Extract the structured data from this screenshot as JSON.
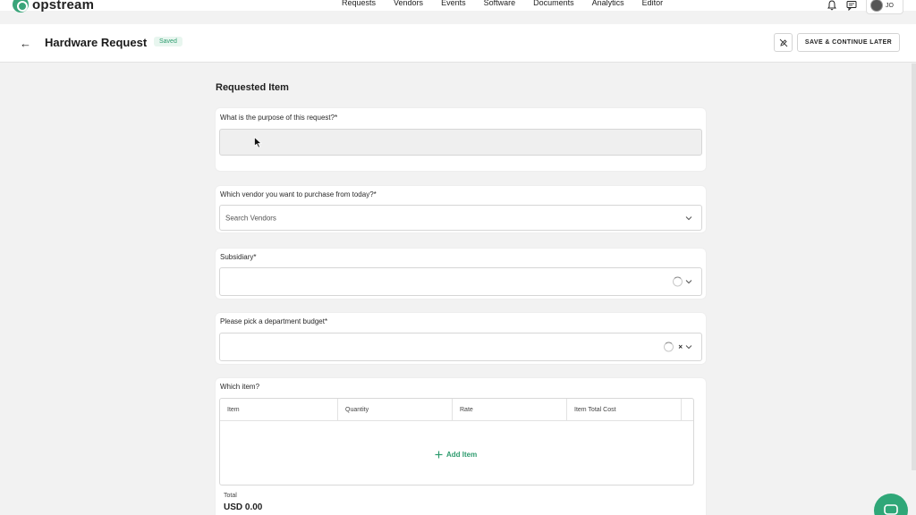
{
  "brand": {
    "name": "opstream",
    "accent": "#2f9c6f"
  },
  "nav": {
    "links": [
      "Requests",
      "Vendors",
      "Events",
      "Software",
      "Documents",
      "Analytics",
      "Editor"
    ],
    "avatar_initials": "JO"
  },
  "header": {
    "title": "Hardware Request",
    "status": "Saved",
    "save_label": "SAVE & CONTINUE LATER"
  },
  "form": {
    "section_title": "Requested Item",
    "purpose": {
      "label": "What is the purpose of this request?*",
      "value": ""
    },
    "vendor": {
      "label": "Which vendor you want to purchase from today?*",
      "placeholder": "Search Vendors"
    },
    "subsidiary": {
      "label": "Subsidiary*"
    },
    "budget": {
      "label": "Please pick a department budget*",
      "clear": "×"
    },
    "items": {
      "label": "Which item?",
      "columns": [
        "Item",
        "Quantity",
        "Rate",
        "Item Total Cost"
      ],
      "add_label": "Add Item",
      "total_label": "Total",
      "total_value": "USD 0.00"
    }
  }
}
